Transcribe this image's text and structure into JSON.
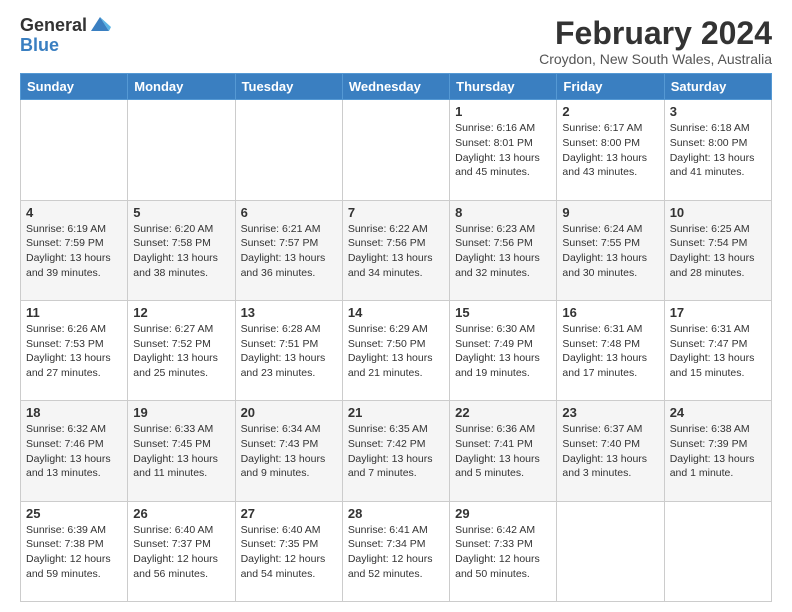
{
  "logo": {
    "general": "General",
    "blue": "Blue"
  },
  "title": "February 2024",
  "location": "Croydon, New South Wales, Australia",
  "days_of_week": [
    "Sunday",
    "Monday",
    "Tuesday",
    "Wednesday",
    "Thursday",
    "Friday",
    "Saturday"
  ],
  "weeks": [
    [
      {
        "day": "",
        "info": ""
      },
      {
        "day": "",
        "info": ""
      },
      {
        "day": "",
        "info": ""
      },
      {
        "day": "",
        "info": ""
      },
      {
        "day": "1",
        "info": "Sunrise: 6:16 AM\nSunset: 8:01 PM\nDaylight: 13 hours\nand 45 minutes."
      },
      {
        "day": "2",
        "info": "Sunrise: 6:17 AM\nSunset: 8:00 PM\nDaylight: 13 hours\nand 43 minutes."
      },
      {
        "day": "3",
        "info": "Sunrise: 6:18 AM\nSunset: 8:00 PM\nDaylight: 13 hours\nand 41 minutes."
      }
    ],
    [
      {
        "day": "4",
        "info": "Sunrise: 6:19 AM\nSunset: 7:59 PM\nDaylight: 13 hours\nand 39 minutes."
      },
      {
        "day": "5",
        "info": "Sunrise: 6:20 AM\nSunset: 7:58 PM\nDaylight: 13 hours\nand 38 minutes."
      },
      {
        "day": "6",
        "info": "Sunrise: 6:21 AM\nSunset: 7:57 PM\nDaylight: 13 hours\nand 36 minutes."
      },
      {
        "day": "7",
        "info": "Sunrise: 6:22 AM\nSunset: 7:56 PM\nDaylight: 13 hours\nand 34 minutes."
      },
      {
        "day": "8",
        "info": "Sunrise: 6:23 AM\nSunset: 7:56 PM\nDaylight: 13 hours\nand 32 minutes."
      },
      {
        "day": "9",
        "info": "Sunrise: 6:24 AM\nSunset: 7:55 PM\nDaylight: 13 hours\nand 30 minutes."
      },
      {
        "day": "10",
        "info": "Sunrise: 6:25 AM\nSunset: 7:54 PM\nDaylight: 13 hours\nand 28 minutes."
      }
    ],
    [
      {
        "day": "11",
        "info": "Sunrise: 6:26 AM\nSunset: 7:53 PM\nDaylight: 13 hours\nand 27 minutes."
      },
      {
        "day": "12",
        "info": "Sunrise: 6:27 AM\nSunset: 7:52 PM\nDaylight: 13 hours\nand 25 minutes."
      },
      {
        "day": "13",
        "info": "Sunrise: 6:28 AM\nSunset: 7:51 PM\nDaylight: 13 hours\nand 23 minutes."
      },
      {
        "day": "14",
        "info": "Sunrise: 6:29 AM\nSunset: 7:50 PM\nDaylight: 13 hours\nand 21 minutes."
      },
      {
        "day": "15",
        "info": "Sunrise: 6:30 AM\nSunset: 7:49 PM\nDaylight: 13 hours\nand 19 minutes."
      },
      {
        "day": "16",
        "info": "Sunrise: 6:31 AM\nSunset: 7:48 PM\nDaylight: 13 hours\nand 17 minutes."
      },
      {
        "day": "17",
        "info": "Sunrise: 6:31 AM\nSunset: 7:47 PM\nDaylight: 13 hours\nand 15 minutes."
      }
    ],
    [
      {
        "day": "18",
        "info": "Sunrise: 6:32 AM\nSunset: 7:46 PM\nDaylight: 13 hours\nand 13 minutes."
      },
      {
        "day": "19",
        "info": "Sunrise: 6:33 AM\nSunset: 7:45 PM\nDaylight: 13 hours\nand 11 minutes."
      },
      {
        "day": "20",
        "info": "Sunrise: 6:34 AM\nSunset: 7:43 PM\nDaylight: 13 hours\nand 9 minutes."
      },
      {
        "day": "21",
        "info": "Sunrise: 6:35 AM\nSunset: 7:42 PM\nDaylight: 13 hours\nand 7 minutes."
      },
      {
        "day": "22",
        "info": "Sunrise: 6:36 AM\nSunset: 7:41 PM\nDaylight: 13 hours\nand 5 minutes."
      },
      {
        "day": "23",
        "info": "Sunrise: 6:37 AM\nSunset: 7:40 PM\nDaylight: 13 hours\nand 3 minutes."
      },
      {
        "day": "24",
        "info": "Sunrise: 6:38 AM\nSunset: 7:39 PM\nDaylight: 13 hours\nand 1 minute."
      }
    ],
    [
      {
        "day": "25",
        "info": "Sunrise: 6:39 AM\nSunset: 7:38 PM\nDaylight: 12 hours\nand 59 minutes."
      },
      {
        "day": "26",
        "info": "Sunrise: 6:40 AM\nSunset: 7:37 PM\nDaylight: 12 hours\nand 56 minutes."
      },
      {
        "day": "27",
        "info": "Sunrise: 6:40 AM\nSunset: 7:35 PM\nDaylight: 12 hours\nand 54 minutes."
      },
      {
        "day": "28",
        "info": "Sunrise: 6:41 AM\nSunset: 7:34 PM\nDaylight: 12 hours\nand 52 minutes."
      },
      {
        "day": "29",
        "info": "Sunrise: 6:42 AM\nSunset: 7:33 PM\nDaylight: 12 hours\nand 50 minutes."
      },
      {
        "day": "",
        "info": ""
      },
      {
        "day": "",
        "info": ""
      }
    ]
  ]
}
